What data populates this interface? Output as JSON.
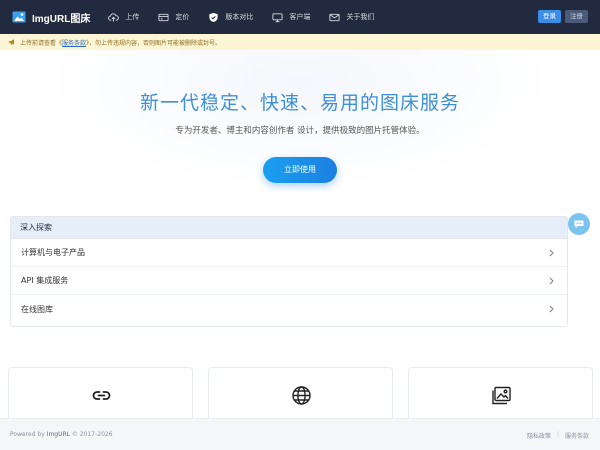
{
  "navbar": {
    "brand": "ImgURL图床",
    "items": [
      {
        "label": "上传",
        "icon": "cloud-upload-icon"
      },
      {
        "label": "定价",
        "icon": "price-card-icon"
      },
      {
        "label": "版本对比",
        "icon": "shield-check-icon"
      },
      {
        "label": "客户端",
        "icon": "monitor-icon"
      },
      {
        "label": "关于我们",
        "icon": "mail-icon"
      }
    ],
    "login_label": "登录",
    "register_label": "注册"
  },
  "notice": {
    "prefix": "上传前请查看《",
    "link": "服务条款",
    "suffix": "》，勿上传违规内容，否则图片可能被删除或封号。"
  },
  "hero": {
    "title": "新一代稳定、快速、易用的图床服务",
    "subtitle": "专为开发者、博主和内容创作者 设计，提供极致的图片托管体验。",
    "cta_label": "立即使用"
  },
  "explore": {
    "title": "深入探索",
    "items": [
      "计算机与电子产品",
      "API 集成服务",
      "在线图库"
    ]
  },
  "cards": [
    "link-icon",
    "globe-icon",
    "image-gallery-icon"
  ],
  "footer": {
    "powered_prefix": "Powered by ",
    "powered_brand": "ImgURL",
    "copyright": " © 2017-2026",
    "privacy": "隐私政策",
    "separator": "|",
    "terms": "服务条款"
  },
  "colors": {
    "navbar_bg": "#212a3e",
    "accent": "#3d8fd9",
    "notice_bg": "#fdf6d6",
    "login_bg": "#3a8ee6"
  }
}
